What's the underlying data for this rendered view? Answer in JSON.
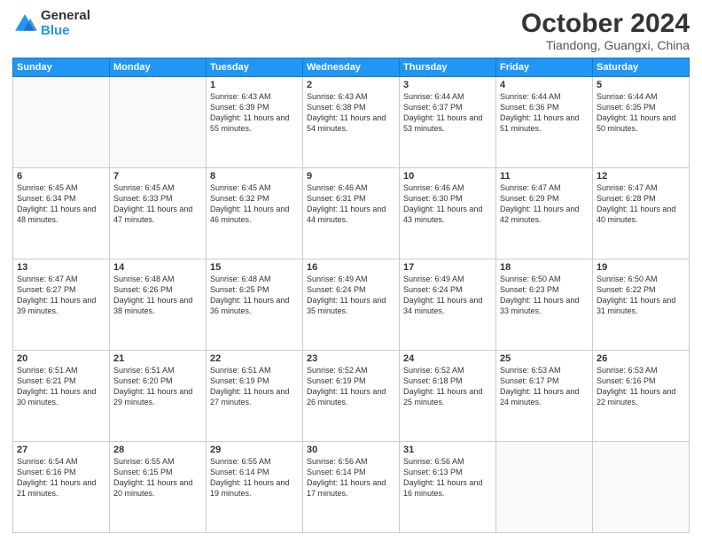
{
  "logo": {
    "general": "General",
    "blue": "Blue"
  },
  "header": {
    "month": "October 2024",
    "location": "Tiandong, Guangxi, China"
  },
  "weekdays": [
    "Sunday",
    "Monday",
    "Tuesday",
    "Wednesday",
    "Thursday",
    "Friday",
    "Saturday"
  ],
  "weeks": [
    [
      {
        "day": "",
        "info": ""
      },
      {
        "day": "",
        "info": ""
      },
      {
        "day": "1",
        "info": "Sunrise: 6:43 AM\nSunset: 6:39 PM\nDaylight: 11 hours and 55 minutes."
      },
      {
        "day": "2",
        "info": "Sunrise: 6:43 AM\nSunset: 6:38 PM\nDaylight: 11 hours and 54 minutes."
      },
      {
        "day": "3",
        "info": "Sunrise: 6:44 AM\nSunset: 6:37 PM\nDaylight: 11 hours and 53 minutes."
      },
      {
        "day": "4",
        "info": "Sunrise: 6:44 AM\nSunset: 6:36 PM\nDaylight: 11 hours and 51 minutes."
      },
      {
        "day": "5",
        "info": "Sunrise: 6:44 AM\nSunset: 6:35 PM\nDaylight: 11 hours and 50 minutes."
      }
    ],
    [
      {
        "day": "6",
        "info": "Sunrise: 6:45 AM\nSunset: 6:34 PM\nDaylight: 11 hours and 48 minutes."
      },
      {
        "day": "7",
        "info": "Sunrise: 6:45 AM\nSunset: 6:33 PM\nDaylight: 11 hours and 47 minutes."
      },
      {
        "day": "8",
        "info": "Sunrise: 6:45 AM\nSunset: 6:32 PM\nDaylight: 11 hours and 46 minutes."
      },
      {
        "day": "9",
        "info": "Sunrise: 6:46 AM\nSunset: 6:31 PM\nDaylight: 11 hours and 44 minutes."
      },
      {
        "day": "10",
        "info": "Sunrise: 6:46 AM\nSunset: 6:30 PM\nDaylight: 11 hours and 43 minutes."
      },
      {
        "day": "11",
        "info": "Sunrise: 6:47 AM\nSunset: 6:29 PM\nDaylight: 11 hours and 42 minutes."
      },
      {
        "day": "12",
        "info": "Sunrise: 6:47 AM\nSunset: 6:28 PM\nDaylight: 11 hours and 40 minutes."
      }
    ],
    [
      {
        "day": "13",
        "info": "Sunrise: 6:47 AM\nSunset: 6:27 PM\nDaylight: 11 hours and 39 minutes."
      },
      {
        "day": "14",
        "info": "Sunrise: 6:48 AM\nSunset: 6:26 PM\nDaylight: 11 hours and 38 minutes."
      },
      {
        "day": "15",
        "info": "Sunrise: 6:48 AM\nSunset: 6:25 PM\nDaylight: 11 hours and 36 minutes."
      },
      {
        "day": "16",
        "info": "Sunrise: 6:49 AM\nSunset: 6:24 PM\nDaylight: 11 hours and 35 minutes."
      },
      {
        "day": "17",
        "info": "Sunrise: 6:49 AM\nSunset: 6:24 PM\nDaylight: 11 hours and 34 minutes."
      },
      {
        "day": "18",
        "info": "Sunrise: 6:50 AM\nSunset: 6:23 PM\nDaylight: 11 hours and 33 minutes."
      },
      {
        "day": "19",
        "info": "Sunrise: 6:50 AM\nSunset: 6:22 PM\nDaylight: 11 hours and 31 minutes."
      }
    ],
    [
      {
        "day": "20",
        "info": "Sunrise: 6:51 AM\nSunset: 6:21 PM\nDaylight: 11 hours and 30 minutes."
      },
      {
        "day": "21",
        "info": "Sunrise: 6:51 AM\nSunset: 6:20 PM\nDaylight: 11 hours and 29 minutes."
      },
      {
        "day": "22",
        "info": "Sunrise: 6:51 AM\nSunset: 6:19 PM\nDaylight: 11 hours and 27 minutes."
      },
      {
        "day": "23",
        "info": "Sunrise: 6:52 AM\nSunset: 6:19 PM\nDaylight: 11 hours and 26 minutes."
      },
      {
        "day": "24",
        "info": "Sunrise: 6:52 AM\nSunset: 6:18 PM\nDaylight: 11 hours and 25 minutes."
      },
      {
        "day": "25",
        "info": "Sunrise: 6:53 AM\nSunset: 6:17 PM\nDaylight: 11 hours and 24 minutes."
      },
      {
        "day": "26",
        "info": "Sunrise: 6:53 AM\nSunset: 6:16 PM\nDaylight: 11 hours and 22 minutes."
      }
    ],
    [
      {
        "day": "27",
        "info": "Sunrise: 6:54 AM\nSunset: 6:16 PM\nDaylight: 11 hours and 21 minutes."
      },
      {
        "day": "28",
        "info": "Sunrise: 6:55 AM\nSunset: 6:15 PM\nDaylight: 11 hours and 20 minutes."
      },
      {
        "day": "29",
        "info": "Sunrise: 6:55 AM\nSunset: 6:14 PM\nDaylight: 11 hours and 19 minutes."
      },
      {
        "day": "30",
        "info": "Sunrise: 6:56 AM\nSunset: 6:14 PM\nDaylight: 11 hours and 17 minutes."
      },
      {
        "day": "31",
        "info": "Sunrise: 6:56 AM\nSunset: 6:13 PM\nDaylight: 11 hours and 16 minutes."
      },
      {
        "day": "",
        "info": ""
      },
      {
        "day": "",
        "info": ""
      }
    ]
  ]
}
